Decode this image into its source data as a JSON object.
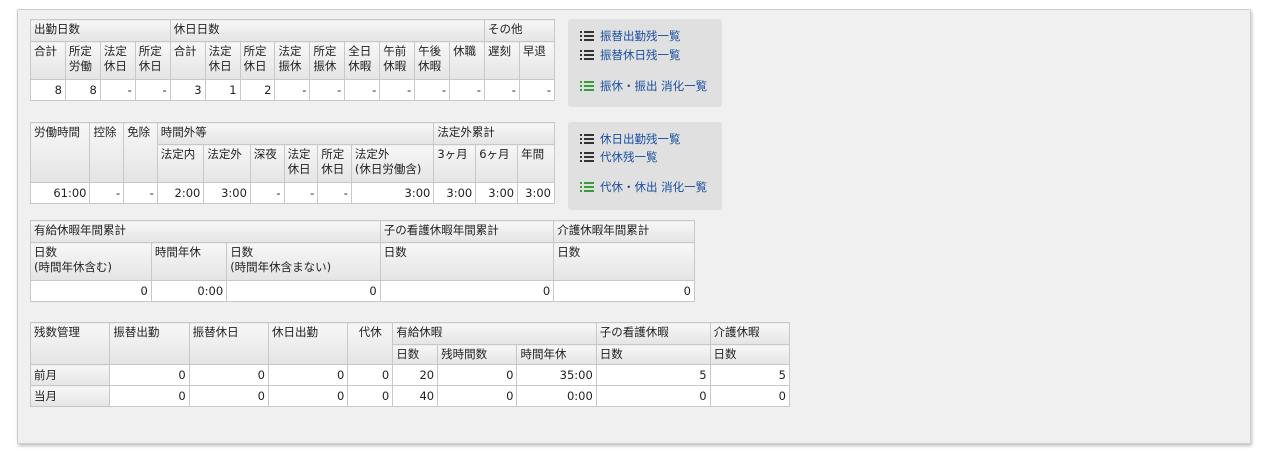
{
  "attendance_table": {
    "group_headers": [
      "出勤日数",
      "休日日数",
      "その他"
    ],
    "sub_headers": [
      [
        "合計"
      ],
      [
        "所定",
        "労働"
      ],
      [
        "法定",
        "休日"
      ],
      [
        "所定",
        "休日"
      ],
      [
        "合計"
      ],
      [
        "法定",
        "休日"
      ],
      [
        "所定",
        "休日"
      ],
      [
        "法定",
        "振休"
      ],
      [
        "所定",
        "振休"
      ],
      [
        "全日",
        "休暇"
      ],
      [
        "午前",
        "休暇"
      ],
      [
        "午後",
        "休暇"
      ],
      [
        "休職"
      ],
      [
        "遅刻"
      ],
      [
        "早退"
      ]
    ],
    "values": [
      "8",
      "8",
      "-",
      "-",
      "3",
      "1",
      "2",
      "-",
      "-",
      "-",
      "-",
      "-",
      "-",
      "-",
      "-"
    ]
  },
  "work_time_table": {
    "labels": {
      "work_hours": "労働時間",
      "deduction": "控除",
      "exemption": "免除",
      "overtime": "時間外等",
      "legal_excess_cumulative": "法定外累計"
    },
    "overtime_sub": [
      [
        "法定内"
      ],
      [
        "法定外"
      ],
      [
        "深夜"
      ],
      [
        "法定",
        "休日"
      ],
      [
        "所定",
        "休日"
      ],
      [
        "法定外",
        "(休日労働含)"
      ]
    ],
    "cumulative_sub": [
      "3ヶ月",
      "6ヶ月",
      "年間"
    ],
    "values": [
      "61:00",
      "-",
      "-",
      "2:00",
      "3:00",
      "-",
      "-",
      "-",
      "3:00",
      "3:00",
      "3:00",
      "3:00"
    ]
  },
  "annual_leave_table": {
    "groups": [
      "有給休暇年間累計",
      "子の看護休暇年間累計",
      "介護休暇年間累計"
    ],
    "sub": [
      [
        "日数",
        "(時間年休含む)"
      ],
      [
        "時間年休"
      ],
      [
        "日数",
        "(時間年休含まない)"
      ],
      [
        "日数"
      ],
      [
        "日数"
      ]
    ],
    "values": [
      "0",
      "0:00",
      "0",
      "0",
      "0"
    ]
  },
  "balance_table": {
    "headers": {
      "mgmt": "残数管理",
      "transfer_work": "振替出勤",
      "transfer_holiday": "振替休日",
      "holiday_work": "休日出勤",
      "comp": "代休",
      "paid": "有給休暇",
      "child_care": "子の看護休暇",
      "nursing": "介護休暇"
    },
    "paid_sub": [
      "日数",
      "残時間数",
      "時間年休"
    ],
    "child_sub": "日数",
    "nursing_sub": "日数",
    "rows": [
      {
        "label": "前月",
        "values": [
          "0",
          "0",
          "0",
          "0",
          "20",
          "0",
          "35:00",
          "5",
          "5"
        ]
      },
      {
        "label": "当月",
        "values": [
          "0",
          "0",
          "0",
          "0",
          "40",
          "0",
          "0:00",
          "0",
          "0"
        ]
      }
    ]
  },
  "links_group1": {
    "items": [
      "振替出勤残一覧",
      "振替休日残一覧"
    ],
    "green": "振休・振出 消化一覧"
  },
  "links_group2": {
    "items": [
      "休日出勤残一覧",
      "代休残一覧"
    ],
    "green": "代休・休出 消化一覧"
  },
  "colors": {
    "link": "#1a4fa0",
    "green_icon": "#3a9c3a",
    "header_bg": "#e4e4e4",
    "panel_bg": "#f0f0f0"
  }
}
